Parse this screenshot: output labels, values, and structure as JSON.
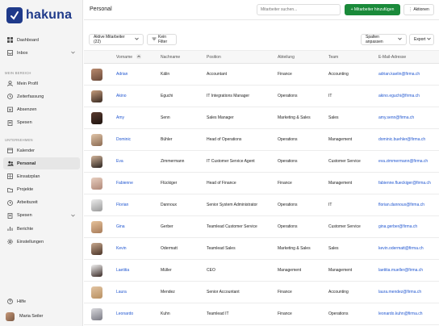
{
  "app": {
    "logo_text": "hakuna"
  },
  "header": {
    "title": "Personal",
    "search_placeholder": "Mitarbeiter suchen...",
    "add_label": "+ Mitarbeiter hinzufügen",
    "actions_label": "⋮ Aktionen"
  },
  "sidebar": {
    "top_items": [
      {
        "label": "Dashboard",
        "icon": "grid-icon"
      },
      {
        "label": "Inbox",
        "icon": "inbox-icon"
      }
    ],
    "section_my": "MEIN BEREICH",
    "my_items": [
      {
        "label": "Mein Profil",
        "icon": "user-icon"
      },
      {
        "label": "Zeiterfassung",
        "icon": "clock-icon"
      },
      {
        "label": "Absenzen",
        "icon": "calendar-x-icon"
      },
      {
        "label": "Spesen",
        "icon": "receipt-icon"
      }
    ],
    "section_company": "UNTERNEHMEN",
    "company_items": [
      {
        "label": "Kalender",
        "icon": "calendar-icon"
      },
      {
        "label": "Personal",
        "icon": "users-icon"
      },
      {
        "label": "Einsatzplan",
        "icon": "plan-icon"
      },
      {
        "label": "Projekte",
        "icon": "folder-icon"
      },
      {
        "label": "Arbeitszeit",
        "icon": "time-icon"
      },
      {
        "label": "Spesen",
        "icon": "receipt-icon"
      },
      {
        "label": "Berichte",
        "icon": "chart-icon"
      },
      {
        "label": "Einstellungen",
        "icon": "gear-icon"
      }
    ],
    "help_label": "Hilfe",
    "user_name": "Maria Seiler"
  },
  "toolbar": {
    "filter_active": "Aktive Mitarbeiter (22)",
    "no_filter": "Kein Filter",
    "columns_label": "Spalten anpassen",
    "export_label": "Export"
  },
  "table": {
    "headers": [
      "Vorname",
      "Nachname",
      "Position",
      "Abteilung",
      "Team",
      "E-Mail-Adresse"
    ],
    "rows": [
      {
        "first": "Adrian",
        "last": "Kälin",
        "position": "Accountant",
        "dept": "Finance",
        "team": "Accounting",
        "email": "adrian.kaelin@firma.ch"
      },
      {
        "first": "Akino",
        "last": "Eguchi",
        "position": "IT Integrations Manager",
        "dept": "Operations",
        "team": "IT",
        "email": "akino.eguchi@firma.ch"
      },
      {
        "first": "Amy",
        "last": "Senn",
        "position": "Sales Manager",
        "dept": "Marketing & Sales",
        "team": "Sales",
        "email": "amy.senn@firma.ch"
      },
      {
        "first": "Dominic",
        "last": "Bühler",
        "position": "Head of Operations",
        "dept": "Operations",
        "team": "Management",
        "email": "dominic.buehler@firma.ch"
      },
      {
        "first": "Eva",
        "last": "Zimmermann",
        "position": "IT Customer Service Agent",
        "dept": "Operations",
        "team": "Customer Service",
        "email": "eva.zimmermann@firma.ch"
      },
      {
        "first": "Fabienne",
        "last": "Flückiger",
        "position": "Head of Finance",
        "dept": "Finance",
        "team": "Management",
        "email": "fabienne.flueckiger@firma.ch"
      },
      {
        "first": "Florian",
        "last": "Dannoux",
        "position": "Senior System Administrator",
        "dept": "Operations",
        "team": "IT",
        "email": "florian.dannoux@firma.ch"
      },
      {
        "first": "Gina",
        "last": "Gerber",
        "position": "Teamlead Customer Service",
        "dept": "Operations",
        "team": "Customer Service",
        "email": "gina.gerber@firma.ch"
      },
      {
        "first": "Kevin",
        "last": "Odermatt",
        "position": "Teamlead Sales",
        "dept": "Marketing & Sales",
        "team": "Sales",
        "email": "kevin.odermatt@firma.ch"
      },
      {
        "first": "Laetitia",
        "last": "Müller",
        "position": "CEO",
        "dept": "Management",
        "team": "Management",
        "email": "laetitia.mueller@firma.ch"
      },
      {
        "first": "Laura",
        "last": "Mendez",
        "position": "Senior Accountant",
        "dept": "Finance",
        "team": "Accounting",
        "email": "laura.mendez@firma.ch"
      },
      {
        "first": "Leonardo",
        "last": "Kuhn",
        "position": "Teamlead IT",
        "dept": "Finance",
        "team": "Operations",
        "email": "leonardo.kuhn@firma.ch"
      }
    ]
  },
  "colors": {
    "primary": "#1a8a3a",
    "brand": "#1f3a8a",
    "link": "#2056d0"
  }
}
